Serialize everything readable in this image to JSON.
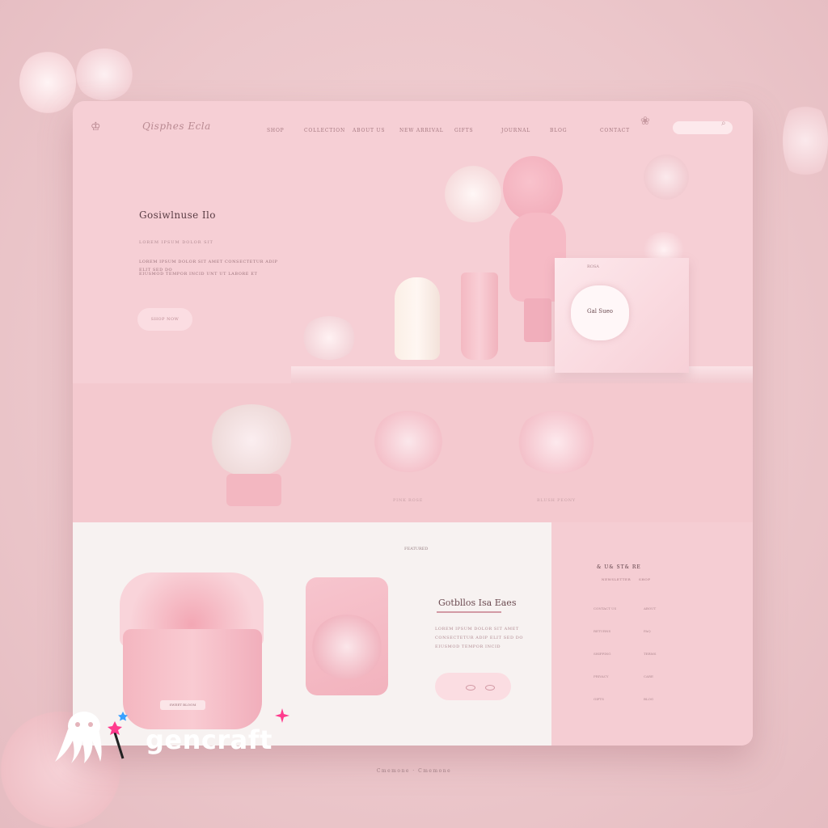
{
  "nav": {
    "logo_mark": "♔",
    "logo_text": "Qisphes Ecla",
    "links": [
      "SHOP",
      "COLLECTION",
      "ABOUT US",
      "NEW ARRIVAL",
      "GIFTS",
      "JOURNAL",
      "BLOG",
      "CONTACT"
    ],
    "icon": "flower-icon",
    "search_icon": "⌕"
  },
  "hero": {
    "title": "Gosiwlnuse Ilo",
    "subtitle": "LOREM IPSUM DOLOR SIT",
    "body_lines": [
      "LOREM IPSUM DOLOR SIT AMET CONSECTETUR ADIP ELIT SED DO",
      "EIUSMOD TEMPOR INCID UNT UT LABORE ET"
    ],
    "button": "SHOP NOW",
    "box_top": "ROSA",
    "box_label": "Gal Sueo"
  },
  "products": {
    "captions": [
      "PINK ROSE",
      "BLUSH PEONY"
    ]
  },
  "lower": {
    "tag": "FEATURED",
    "pot_label": "SWEET BLOOM",
    "title": "Gotbllos Isa Eaes",
    "body_lines": [
      "LOREM IPSUM DOLOR SIT AMET",
      "CONSECTETUR ADIP ELIT SED DO",
      "EIUSMOD TEMPOR INCID"
    ]
  },
  "side": {
    "title": "& U& ST& RE",
    "subtitle_left": "NEWSLETTER",
    "subtitle_right": "SHOP",
    "rows": [
      [
        "CONTACT US",
        "ABOUT"
      ],
      [
        "RETURNS",
        "FAQ"
      ],
      [
        "SHIPPING",
        "TERMS"
      ],
      [
        "PRIVACY",
        "CARE"
      ],
      [
        "GIFTS",
        "BLOG"
      ]
    ]
  },
  "footer": {
    "text": "Cmemone · Cmemone"
  },
  "watermark": {
    "brand": "gencraft"
  },
  "colors": {
    "accent": "#f6cfd5",
    "ink": "#5a3d44",
    "white_panel": "#f7f2f1"
  }
}
